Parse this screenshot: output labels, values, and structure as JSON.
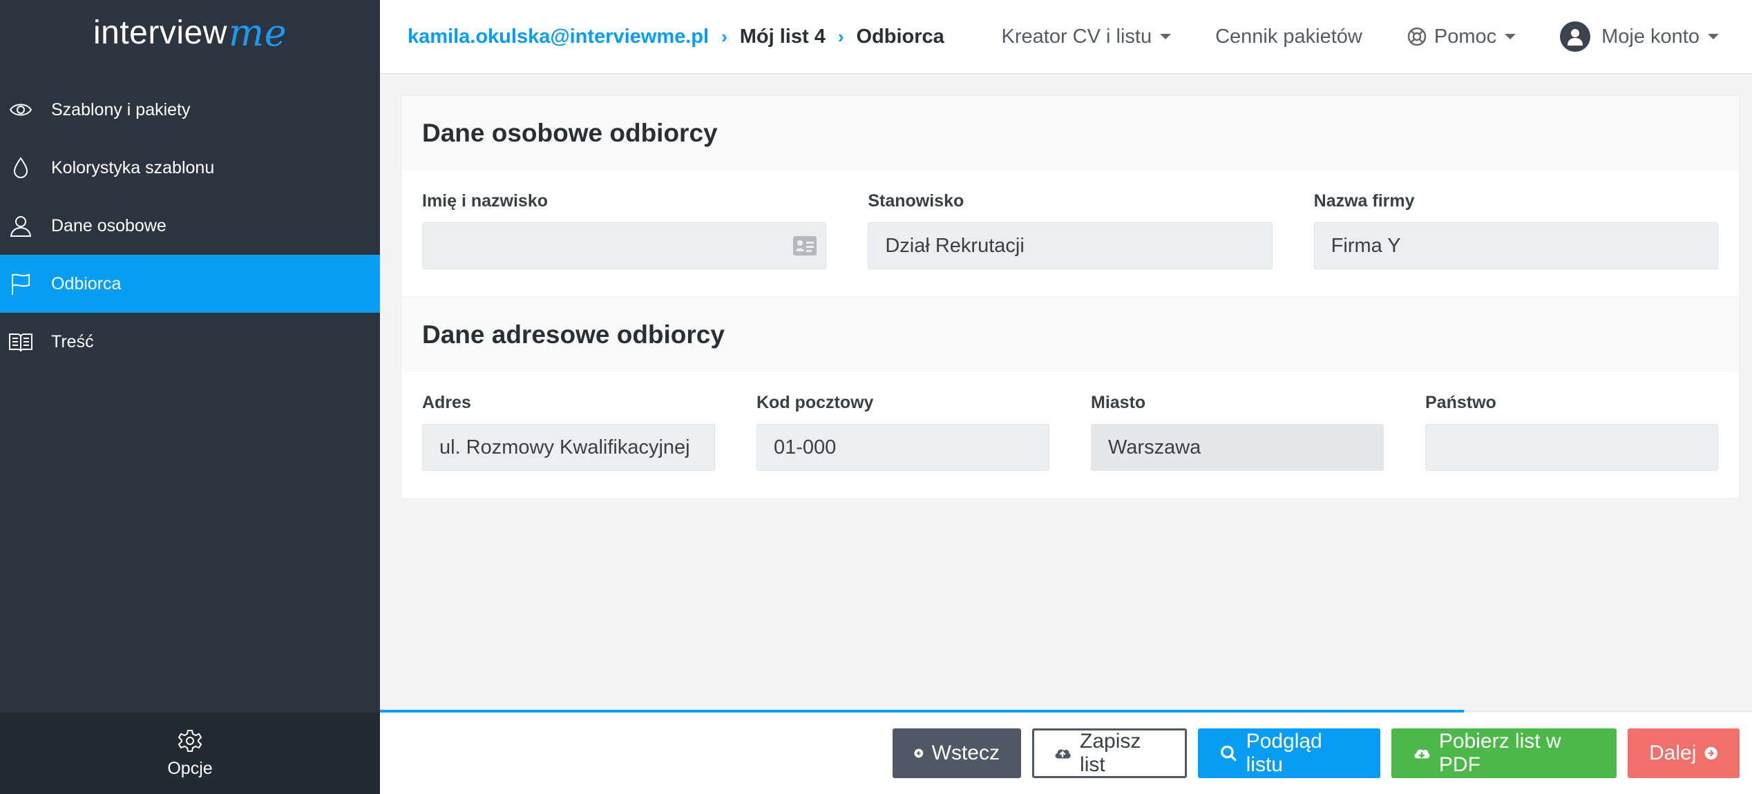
{
  "app": {
    "logo_main": "interview",
    "logo_accent": "me"
  },
  "sidebar": {
    "items": [
      {
        "label": "Szablony i pakiety",
        "icon": "eye-icon"
      },
      {
        "label": "Kolorystyka szablonu",
        "icon": "droplet-icon"
      },
      {
        "label": "Dane osobowe",
        "icon": "user-icon"
      },
      {
        "label": "Odbiorca",
        "icon": "flag-icon",
        "active": true
      },
      {
        "label": "Treść",
        "icon": "book-icon"
      }
    ],
    "footer_label": "Opcje"
  },
  "breadcrumb": {
    "account": "kamila.okulska@interviewme.pl",
    "document": "Mój list 4",
    "current": "Odbiorca",
    "separator": "›"
  },
  "top_nav": {
    "creator": "Kreator CV i listu",
    "pricing": "Cennik pakietów",
    "help": "Pomoc",
    "account": "Moje konto"
  },
  "personal": {
    "title": "Dane osobowe odbiorcy",
    "name_label": "Imię i nazwisko",
    "name_value": "",
    "position_label": "Stanowisko",
    "position_value": "Dział Rekrutacji",
    "company_label": "Nazwa firmy",
    "company_value": "Firma Y"
  },
  "address": {
    "title": "Dane adresowe odbiorcy",
    "street_label": "Adres",
    "street_value": "ul. Rozmowy Kwalifikacyjnej",
    "zip_label": "Kod pocztowy",
    "zip_value": "01-000",
    "city_label": "Miasto",
    "city_value": "Warszawa",
    "country_label": "Państwo",
    "country_value": ""
  },
  "progress": 0.79,
  "actions": {
    "back": "Wstecz",
    "save": "Zapisz list",
    "preview": "Podgląd listu",
    "download": "Pobierz list w PDF",
    "next": "Dalej"
  },
  "colors": {
    "accent": "#079df5",
    "sidebar_bg": "#2c3440",
    "green": "#4cb849",
    "red": "#f2706b"
  }
}
